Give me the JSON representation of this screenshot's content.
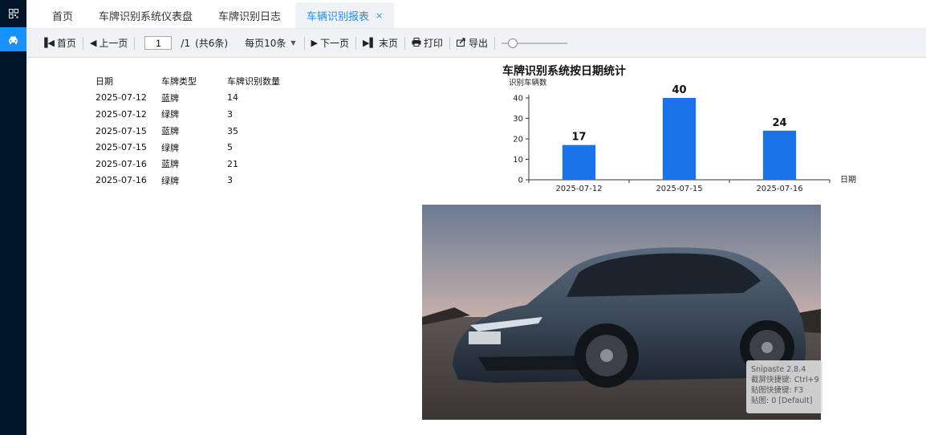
{
  "sidebar": {
    "icons": [
      {
        "name": "qrcode-icon"
      },
      {
        "name": "car-icon",
        "active": true
      }
    ]
  },
  "tabs": [
    {
      "label": "首页"
    },
    {
      "label": "车牌识别系统仪表盘"
    },
    {
      "label": "车牌识别日志"
    },
    {
      "label": "车辆识别报表",
      "active": true,
      "closable": true
    }
  ],
  "toolbar": {
    "first": "首页",
    "prev": "上一页",
    "page_value": "1",
    "page_total": "/1",
    "count_text": "(共6条)",
    "per_page": "每页10条",
    "next": "下一页",
    "last": "末页",
    "print": "打印",
    "export": "导出"
  },
  "table": {
    "headers": [
      "日期",
      "车牌类型",
      "车牌识别数量"
    ],
    "rows": [
      [
        "2025-07-12",
        "蓝牌",
        "14"
      ],
      [
        "2025-07-12",
        "绿牌",
        "3"
      ],
      [
        "2025-07-15",
        "蓝牌",
        "35"
      ],
      [
        "2025-07-15",
        "绿牌",
        "5"
      ],
      [
        "2025-07-16",
        "蓝牌",
        "21"
      ],
      [
        "2025-07-16",
        "绿牌",
        "3"
      ]
    ]
  },
  "chart_data": {
    "type": "bar",
    "title": "车牌识别系统按日期统计",
    "ylabel": "识别车辆数",
    "xlabel": "日期",
    "categories": [
      "2025-07-12",
      "2025-07-15",
      "2025-07-16"
    ],
    "values": [
      17,
      40,
      24
    ],
    "ylim": [
      0,
      40
    ],
    "yticks": [
      0,
      10,
      20,
      30,
      40
    ],
    "bar_color": "#1a73e8",
    "grid": false
  },
  "watermark": {
    "lines": [
      "Snipaste 2.8.4",
      "截屏快捷键: Ctrl+9",
      "贴图快捷键: F3",
      "贴图: 0 [Default]"
    ]
  },
  "colors": {
    "accent": "#1890ff",
    "sidebar": "#001529"
  }
}
